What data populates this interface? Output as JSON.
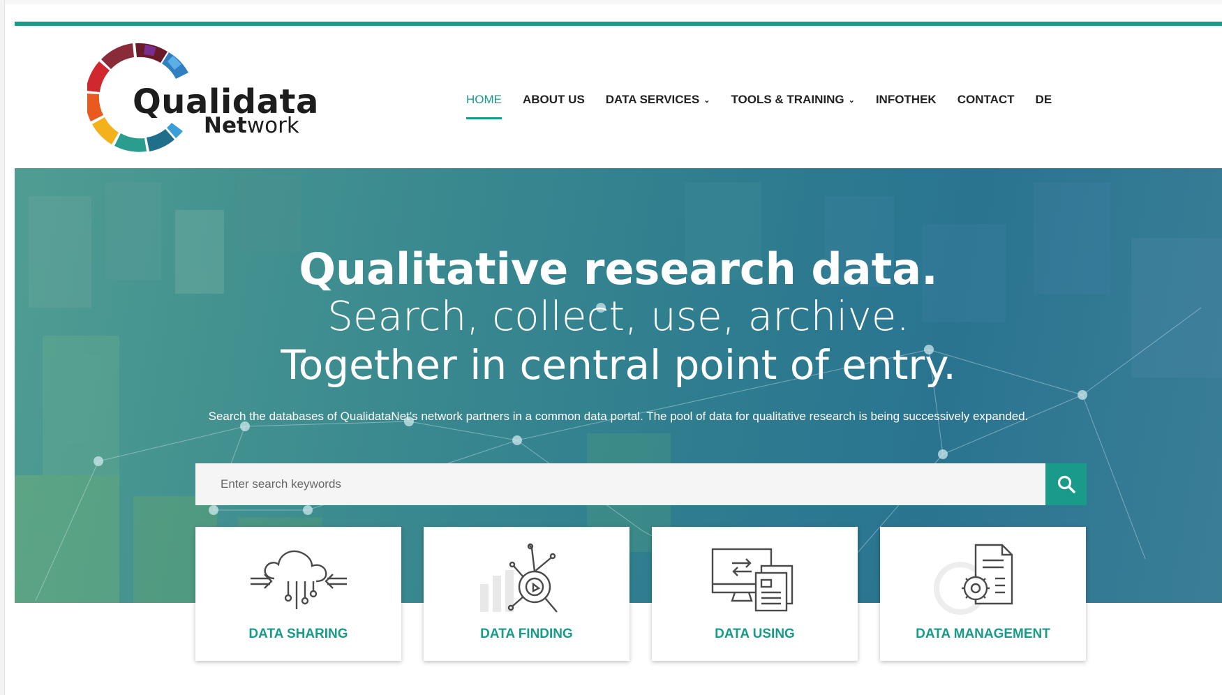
{
  "logo": {
    "line1": "Qualidata",
    "line2_bold": "Net",
    "line2_rest": "work"
  },
  "nav": {
    "items": [
      {
        "label": "HOME",
        "active": true,
        "dropdown": false
      },
      {
        "label": "ABOUT US",
        "active": false,
        "dropdown": false
      },
      {
        "label": "DATA SERVICES",
        "active": false,
        "dropdown": true
      },
      {
        "label": "TOOLS & TRAINING",
        "active": false,
        "dropdown": true
      },
      {
        "label": "INFOTHEK",
        "active": false,
        "dropdown": false
      },
      {
        "label": "CONTACT",
        "active": false,
        "dropdown": false
      },
      {
        "label": "DE",
        "active": false,
        "dropdown": false
      }
    ]
  },
  "hero": {
    "title": "Qualitative research data.",
    "line2": "Search, collect, use, archive.",
    "line3": "Together in central point of entry.",
    "description": "Search the databases of QualidataNet's network partners in a common data portal. The pool of data for qualitative research is being successively expanded."
  },
  "search": {
    "placeholder": "Enter search keywords",
    "value": "",
    "button_icon": "search-icon"
  },
  "cards": [
    {
      "label": "DATA SHARING",
      "icon": "cloud-share-icon"
    },
    {
      "label": "DATA FINDING",
      "icon": "data-finding-icon"
    },
    {
      "label": "DATA USING",
      "icon": "monitor-documents-icon"
    },
    {
      "label": "DATA MANAGEMENT",
      "icon": "document-gear-icon"
    }
  ],
  "colors": {
    "accent": "#1a9a88",
    "text": "#222222",
    "card_icon": "#4a4a4a"
  }
}
